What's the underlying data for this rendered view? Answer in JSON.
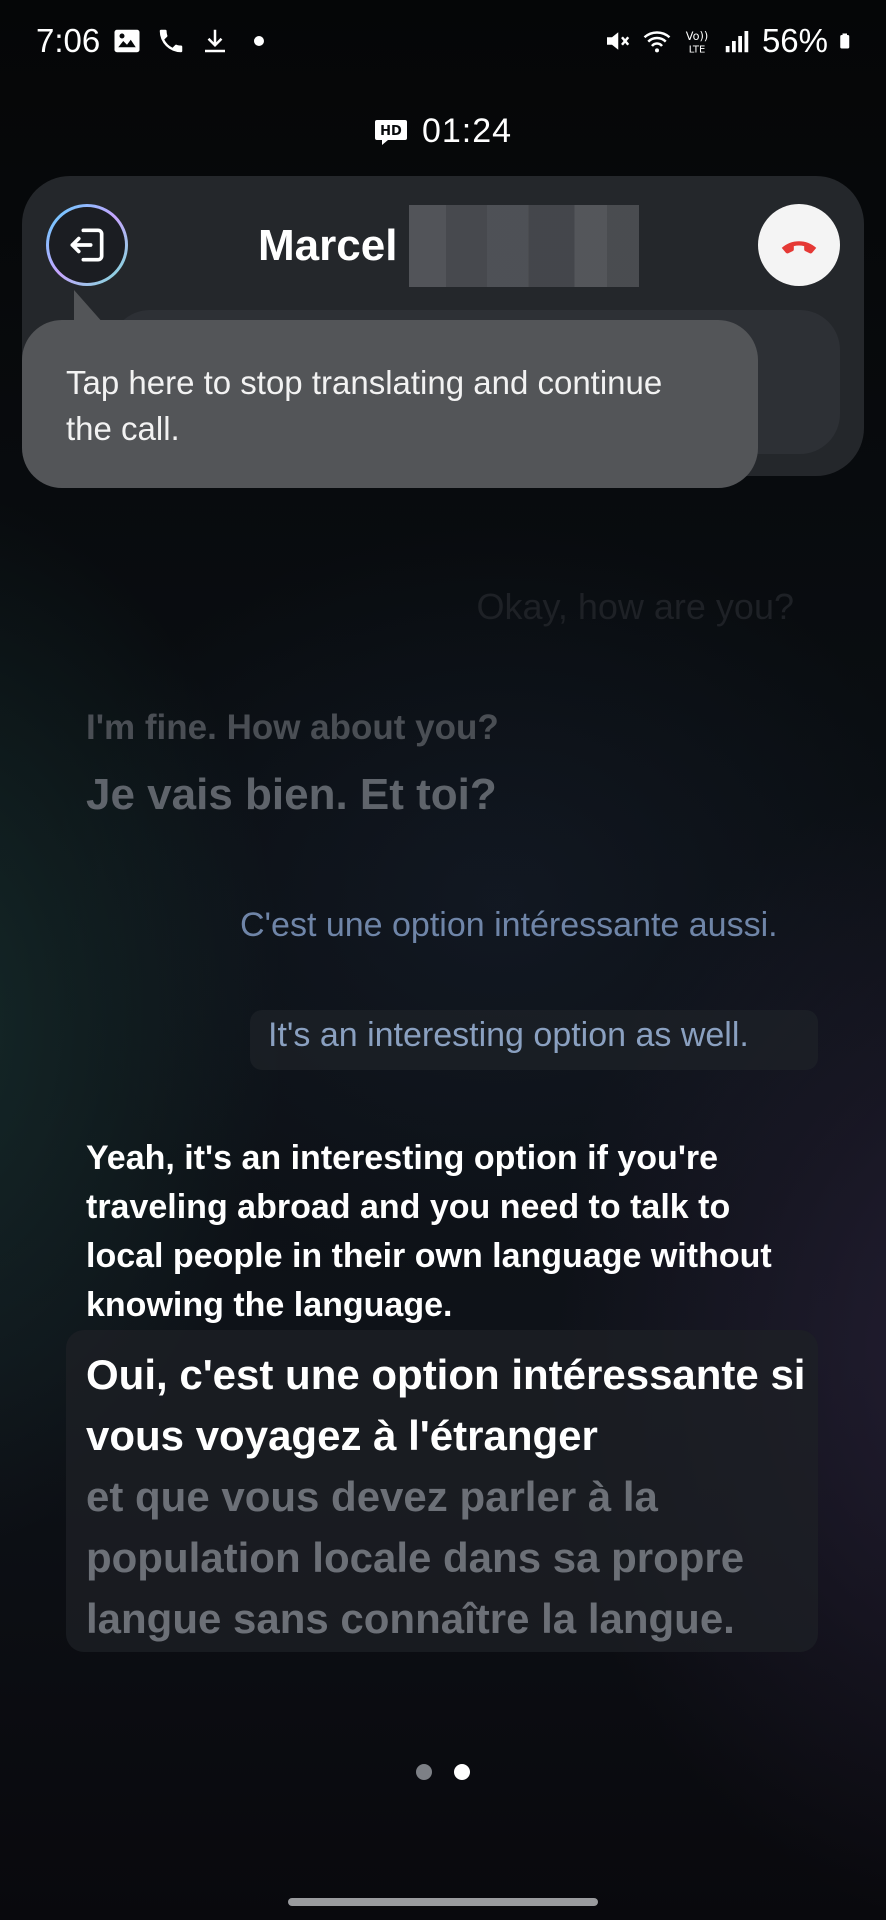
{
  "status_bar": {
    "time": "7:06",
    "left_icons": [
      "image-icon",
      "phone-icon",
      "download-icon",
      "dot-icon"
    ],
    "right_icons": [
      "mute-icon",
      "wifi-icon",
      "volte-icon",
      "signal-icon",
      "battery-icon"
    ],
    "volte_label": "Vo)) LTE",
    "battery_percent": "56%"
  },
  "call": {
    "hd_label": "HD",
    "duration": "01:24",
    "contact_name": "Marcel"
  },
  "tooltip": {
    "text": "Tap here to stop translating and continue the call."
  },
  "conversation": {
    "faded_top": "Okay, how are you?",
    "message1": {
      "original": "I'm fine. How about you?",
      "translation": "Je vais bien. Et toi?"
    },
    "message2": {
      "translation": "C'est une option intéressante aussi.",
      "original": "It's an interesting option as well."
    },
    "message3": {
      "original": "Yeah, it's an interesting option if you're traveling abroad and you need to talk to local people in their own language without knowing the language.",
      "translation_spoken": "Oui, c'est une option intéressante si vous voyagez à l'étranger",
      "translation_pending": "et que vous devez parler à la population locale dans sa propre langue sans connaître la langue."
    }
  },
  "pager": {
    "total": 2,
    "active_index": 1
  },
  "colors": {
    "end_call_red": "#e53935",
    "card_bg": "#24272b",
    "tooltip_bg": "#535558",
    "accent_blue_text": "#6f85a8"
  }
}
